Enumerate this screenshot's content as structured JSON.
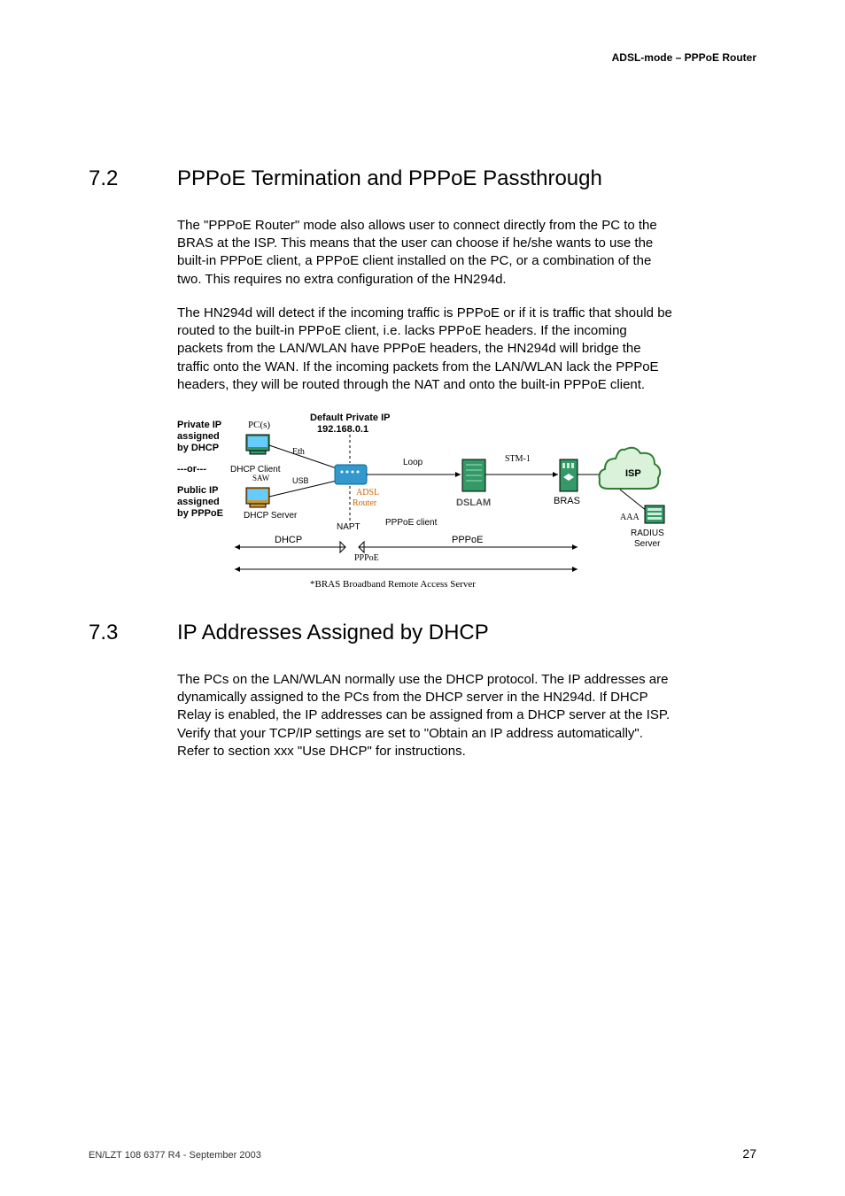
{
  "header": {
    "right": "ADSL-mode – PPPoE Router"
  },
  "sections": {
    "s72": {
      "num": "7.2",
      "title": "PPPoE Termination and PPPoE Passthrough",
      "p1": "The \"PPPoE Router\" mode also allows user to connect directly from the PC to the BRAS at the ISP. This means that the user can choose if he/she wants to use the built-in PPPoE client, a PPPoE client installed on the PC, or a combination of the two. This requires no extra configuration of the HN294d.",
      "p2": "The HN294d will detect if the incoming traffic is PPPoE or if it is traffic that should be routed to the built-in PPPoE client, i.e. lacks PPPoE headers. If the incoming packets from the LAN/WLAN have PPPoE headers, the HN294d will bridge the traffic onto the WAN. If the incoming packets from the LAN/WLAN lack the PPPoE headers, they will be routed through the NAT and onto the built-in PPPoE client."
    },
    "s73": {
      "num": "7.3",
      "title": "IP Addresses Assigned by DHCP",
      "p1": "The PCs on the LAN/WLAN normally use the DHCP protocol. The IP addresses are dynamically assigned to the PCs from the DHCP server in the HN294d. If DHCP Relay is enabled, the IP addresses can be assigned from a DHCP server at the ISP. Verify that your TCP/IP settings are set to \"Obtain an IP address automatically\". Refer to section xxx \"Use DHCP\" for instructions."
    }
  },
  "diagram": {
    "title": "Default Private IP",
    "default_ip": "192.168.0.1",
    "left_labels": {
      "private_ip": "Private IP",
      "assigned1": "assigned",
      "by_dhcp": "by DHCP",
      "or": "---or---",
      "public_ip": "Public IP",
      "assigned2": "assigned",
      "by_pppoe": "by PPPoE"
    },
    "nodes": {
      "pcs": "PC(s)",
      "dhcp_client": "DHCP Client",
      "saw": "SAW",
      "eth": "Eth",
      "usb": "USB",
      "adsl": "ADSL",
      "router": "Router",
      "dhcp_server": "DHCP Server",
      "napt": "NAPT",
      "pppoe_client": "PPPoE client",
      "loop": "Loop",
      "dslam": "DSLAM",
      "stm1": "STM-1",
      "bras": "BRAS",
      "isp": "ISP",
      "aaa": "AAA",
      "radius": "RADIUS",
      "server": "Server"
    },
    "flows": {
      "dhcp": "DHCP",
      "pppoe": "PPPoE",
      "pppoe_small": "PPPoE"
    },
    "footnote": "*BRAS   Broadband Remote Access Server"
  },
  "footer": {
    "left": "EN/LZT 108 6377 R4 - September 2003",
    "page": "27"
  }
}
